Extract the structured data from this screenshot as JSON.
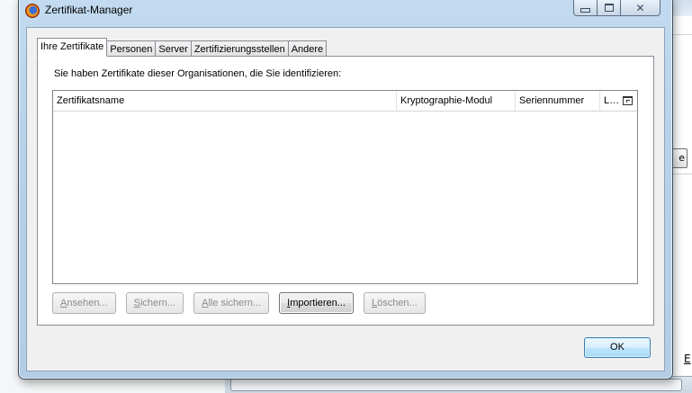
{
  "window": {
    "title": "Zertifikat-Manager",
    "icon": "firefox-icon",
    "controls": {
      "minimize": "minimize-icon",
      "maximize": "maximize-icon",
      "close": "✕"
    }
  },
  "tabs": [
    {
      "label": "Ihre Zertifikate",
      "active": true
    },
    {
      "label": "Personen",
      "active": false
    },
    {
      "label": "Server",
      "active": false
    },
    {
      "label": "Zertifizierungsstellen",
      "active": false
    },
    {
      "label": "Andere",
      "active": false
    }
  ],
  "panel": {
    "caption": "Sie haben Zertifikate dieser Organisationen, die Sie identifizieren:",
    "columns": [
      {
        "label": "Zertifikatsname"
      },
      {
        "label": "Kryptographie-Modul"
      },
      {
        "label": "Seriennummer"
      },
      {
        "label": "L…"
      }
    ],
    "column_picker_icon": "column-picker-icon",
    "rows": []
  },
  "buttons": {
    "view": {
      "accel": "A",
      "rest": "nsehen...",
      "enabled": false
    },
    "backup": {
      "accel": "S",
      "rest": "ichern...",
      "enabled": false
    },
    "backup_all": {
      "accel": "A",
      "rest": "lle sichern...",
      "enabled": false
    },
    "import": {
      "accel": "I",
      "rest": "mportieren...",
      "enabled": true
    },
    "delete": {
      "accel": "L",
      "rest": "öschen...",
      "enabled": false
    }
  },
  "ok_label": "OK",
  "background": {
    "side_button_text": "e",
    "bottom_letter": "E"
  },
  "colors": {
    "frame": "#b9d1e8",
    "client": "#f0f0f0",
    "ok_button": "#bee6fd"
  }
}
